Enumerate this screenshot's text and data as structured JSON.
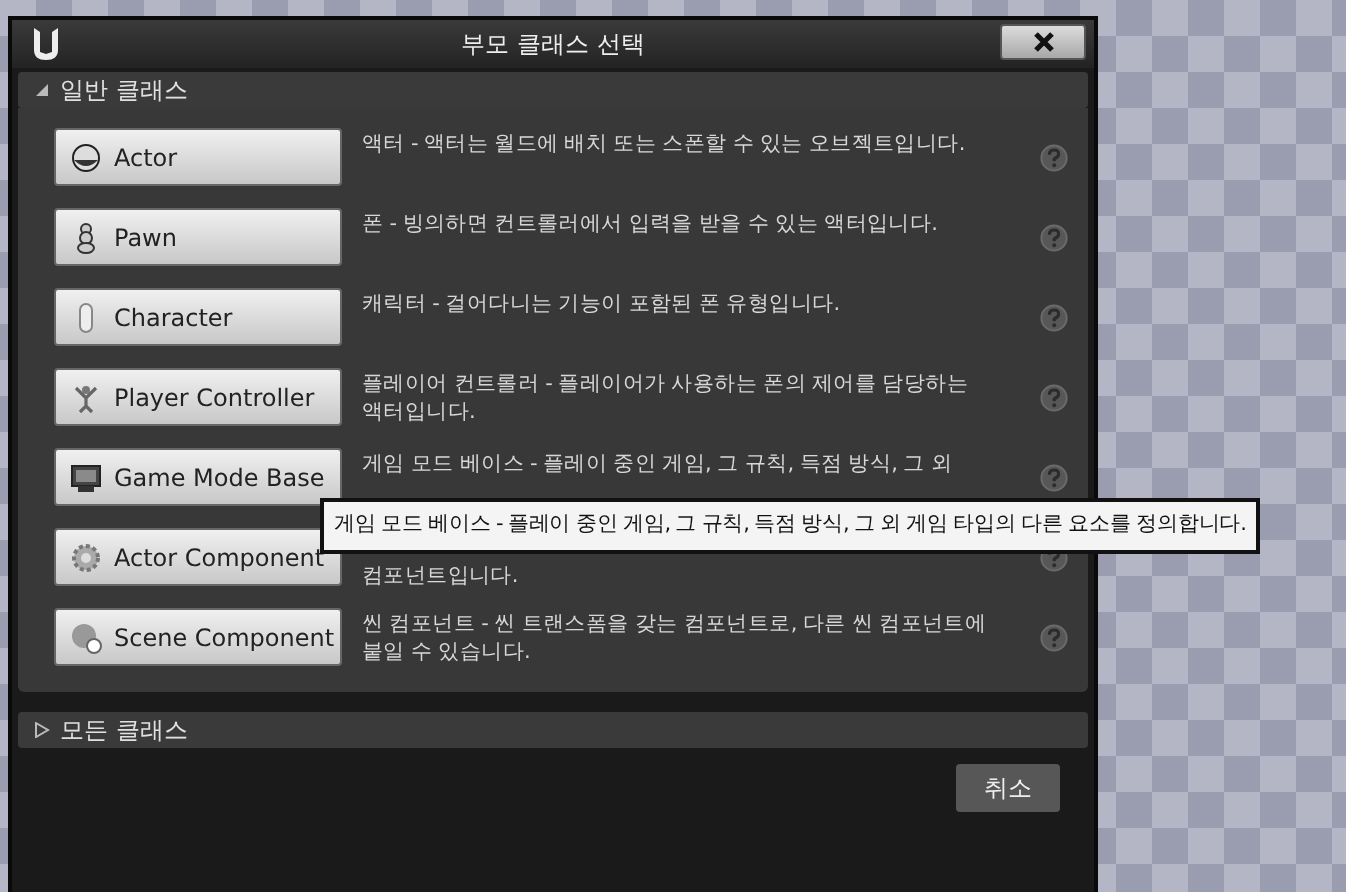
{
  "window": {
    "title": "부모 클래스 선택"
  },
  "sections": [
    {
      "label": "일반 클래스",
      "expanded": true,
      "classes": [
        {
          "name": "Actor",
          "description": [
            "액터 - 액터는 월드에 배치 또는 스폰할 수 있는 오브젝트입니다."
          ]
        },
        {
          "name": "Pawn",
          "description": [
            "폰 - 빙의하면 컨트롤러에서 입력을 받을 수 있는 액터입니다."
          ]
        },
        {
          "name": "Character",
          "description": [
            "캐릭터 - 걸어다니는 기능이 포함된 폰 유형입니다."
          ]
        },
        {
          "name": "Player Controller",
          "description": [
            "플레이어 컨트롤러 - 플레이어가 사용하는 폰의 제어를 담당하는",
            "액터입니다."
          ]
        },
        {
          "name": "Game Mode Base",
          "description": [
            "게임 모드 베이스 - 플레이 중인 게임, 그 규칙, 득점 방식, 그 외"
          ]
        },
        {
          "name": "Actor Component",
          "description": [
            "컴포넌트입니다."
          ],
          "first_line_hidden": true
        },
        {
          "name": "Scene Component",
          "description": [
            "씬 컴포넌트 - 씬 트랜스폼을 갖는 컴포넌트로, 다른 씬 컴포넌트에",
            "붙일 수 있습니다."
          ]
        }
      ]
    },
    {
      "label": "모든 클래스",
      "expanded": false
    }
  ],
  "tooltip": {
    "text": "게임 모드 베이스 - 플레이 중인 게임, 그 규칙, 득점 방식, 그 외 게임 타입의 다른 요소를 정의합니다."
  },
  "buttons": [
    "취소"
  ]
}
